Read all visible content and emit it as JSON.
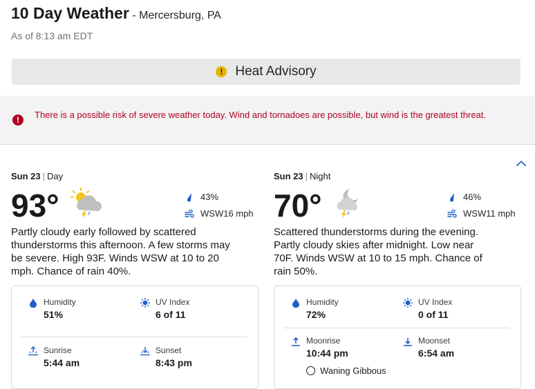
{
  "header": {
    "title": "10 Day Weather",
    "location": "- Mercersburg, PA",
    "as_of": "As of 8:13 am EDT"
  },
  "advisory": {
    "label": "Heat Advisory",
    "icon": "warning-icon",
    "icon_color": "#e6b400"
  },
  "alert": {
    "text": "There is a possible risk of severe weather today. Wind and tornadoes are possible, but wind is the greatest threat.",
    "icon": "error-icon",
    "color": "#b00020"
  },
  "collapse": {
    "icon": "chevron-up-icon"
  },
  "day": {
    "date": "Sun 23",
    "period": "Day",
    "temp": "93°",
    "icon": "partly-cloudy-thunderstorm-sun-icon",
    "precip": "43%",
    "wind": "WSW16 mph",
    "description": "Partly cloudy early followed by scattered thunderstorms this afternoon. A few storms may be severe. High 93F. Winds WSW at 10 to 20 mph. Chance of rain 40%.",
    "humidity_label": "Humidity",
    "humidity": "51%",
    "uv_label": "UV Index",
    "uv": "6 of 11",
    "sunrise_label": "Sunrise",
    "sunrise": "5:44 am",
    "sunset_label": "Sunset",
    "sunset": "8:43 pm"
  },
  "night": {
    "date": "Sun 23",
    "period": "Night",
    "temp": "70°",
    "icon": "partly-cloudy-thunderstorm-moon-icon",
    "precip": "46%",
    "wind": "WSW11 mph",
    "description": "Scattered thunderstorms during the evening. Partly cloudy skies after midnight. Low near 70F. Winds WSW at 10 to 15 mph. Chance of rain 50%.",
    "humidity_label": "Humidity",
    "humidity": "72%",
    "uv_label": "UV Index",
    "uv": "0 of 11",
    "moonrise_label": "Moonrise",
    "moonrise": "10:44 pm",
    "moonset_label": "Moonset",
    "moonset": "6:54 am",
    "moon_phase": "Waning Gibbous"
  },
  "colors": {
    "accent_blue": "#1f5fc9",
    "text": "#1a1a1a"
  }
}
